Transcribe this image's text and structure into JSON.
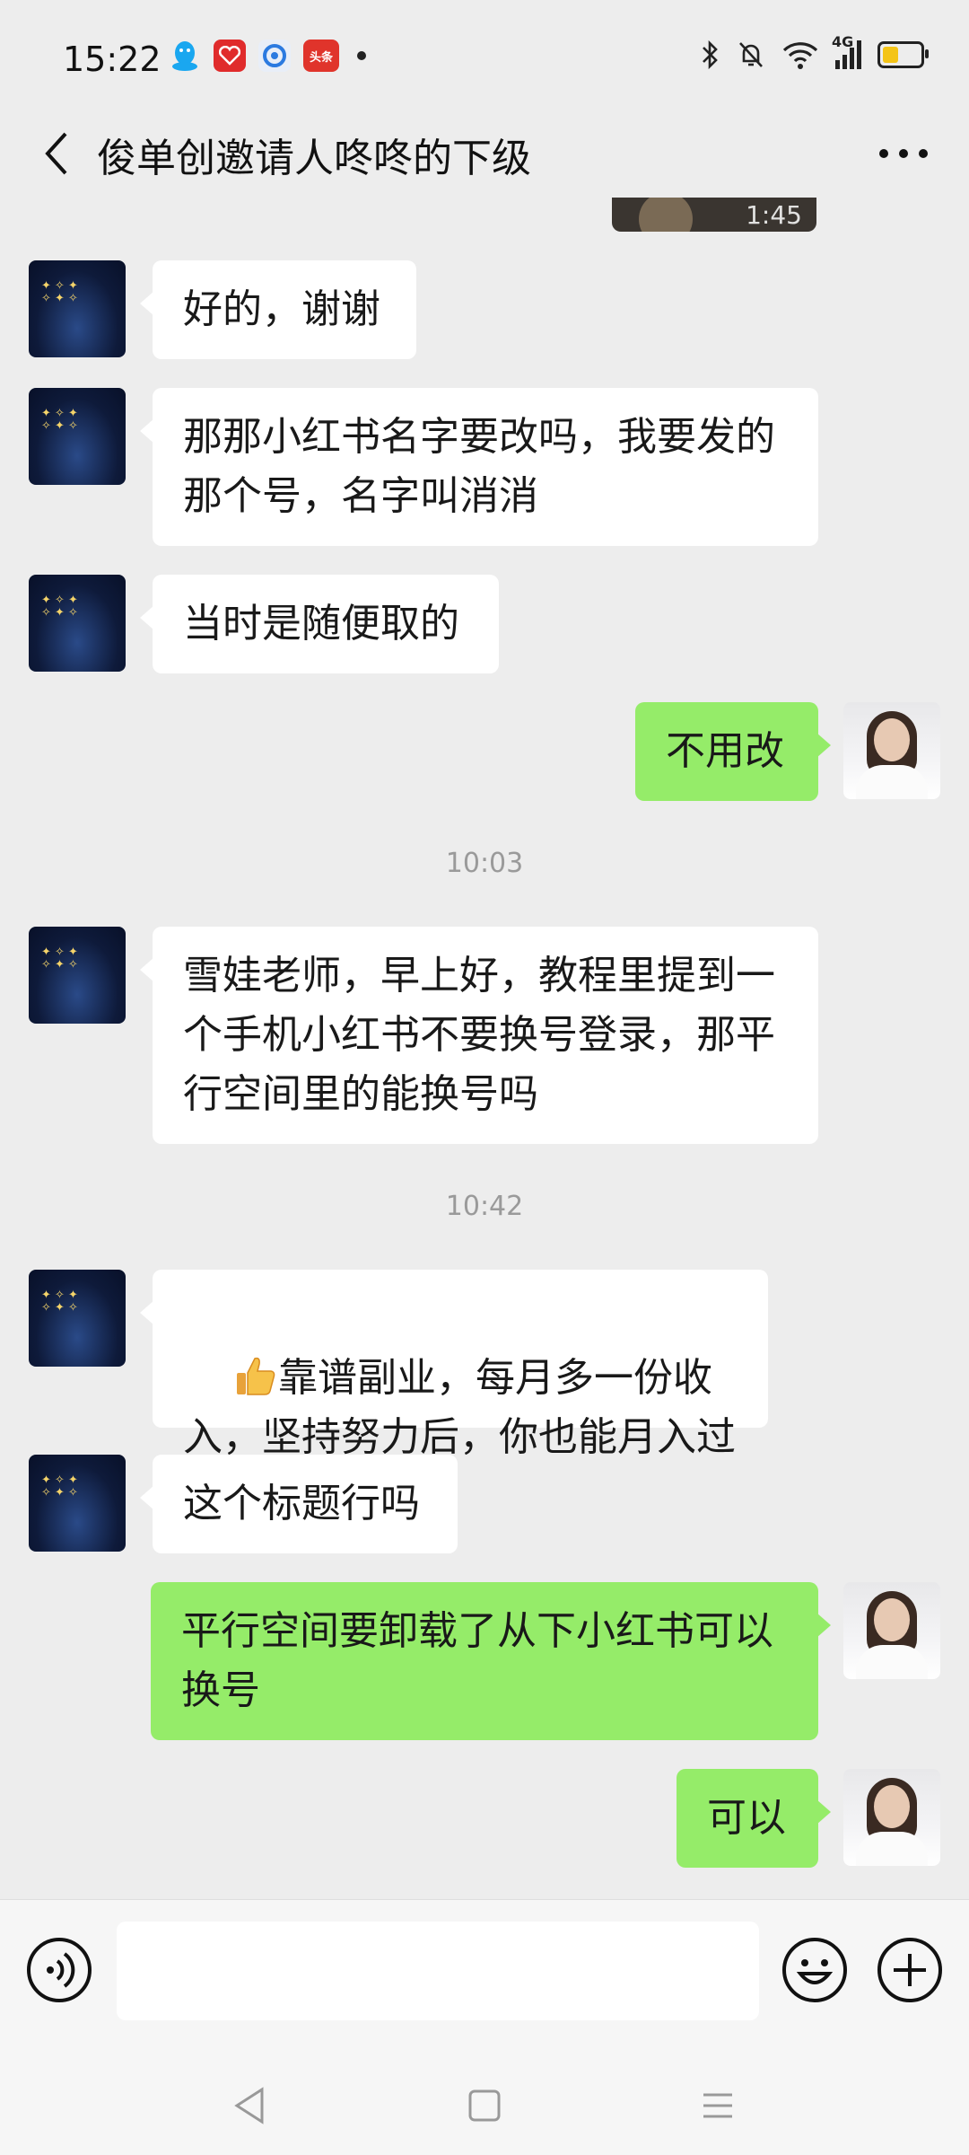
{
  "status_bar": {
    "time": "15:22",
    "app_icons": [
      "qq-icon",
      "heart-app-icon",
      "browser-icon",
      "toutiao-icon"
    ],
    "toutiao_label": "头条",
    "network_label": "4G",
    "battery_level": 0.42,
    "colors": {
      "battery_fill": "#f4c417"
    }
  },
  "header": {
    "title": "俊单创邀请人咚咚的下级"
  },
  "chat": {
    "video_duration": "1:45",
    "messages": [
      {
        "side": "in",
        "text": "好的，谢谢"
      },
      {
        "side": "in",
        "text": "那那小红书名字要改吗，我要发的那个号，名字叫消消"
      },
      {
        "side": "in",
        "text": "当时是随便取的"
      },
      {
        "side": "out",
        "text": "不用改"
      },
      {
        "timestamp": "10:03"
      },
      {
        "side": "in",
        "text": "雪娃老师，早上好，教程里提到一个手机小红书不要换号登录，那平行空间里的能换号吗"
      },
      {
        "timestamp": "10:42"
      },
      {
        "side": "in",
        "text": "靠谱副业，每月多一份收入，坚持努力后，你也能月入过万",
        "emoji": "thumbs-up-icon"
      },
      {
        "side": "in",
        "text": "这个标题行吗"
      },
      {
        "side": "out",
        "text": "平行空间要卸载了从下小红书可以换号"
      },
      {
        "side": "out",
        "text": "可以"
      }
    ]
  },
  "input_bar": {
    "placeholder": ""
  },
  "colors": {
    "background": "#ededed",
    "outgoing_bubble": "#95ec69",
    "incoming_bubble": "#ffffff",
    "timestamp": "#9a9a9a"
  }
}
